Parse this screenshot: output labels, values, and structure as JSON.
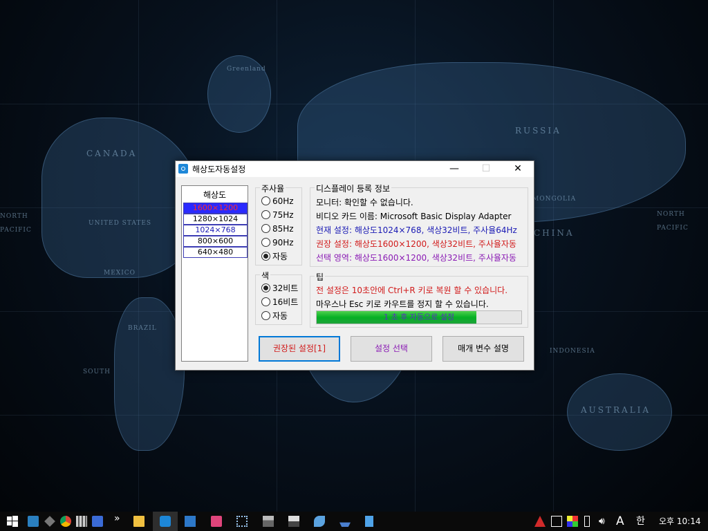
{
  "window": {
    "title": "해상도자동설정",
    "minimize": "—",
    "maximize": "☐",
    "close": "✕"
  },
  "resolution_list": {
    "header": "해상도",
    "items": [
      "1600×1200",
      "1280×1024",
      "1024×768",
      "800×600",
      "640×480"
    ],
    "selected": "1600×1200"
  },
  "refresh_rate": {
    "title": "주사율",
    "options": [
      "60Hz",
      "75Hz",
      "85Hz",
      "90Hz",
      "자동"
    ],
    "selected": "자동"
  },
  "color": {
    "title": "색",
    "options": [
      "32비트",
      "16비트",
      "자동"
    ],
    "selected": "32비트"
  },
  "display_info": {
    "title": "디스플레이 등록 정보",
    "monitor": "모니터: 확인할 수 없습니다.",
    "video_card": "비디오 카드 이름: Microsoft Basic Display Adapter",
    "current": "현재 설정: 해상도1024×768, 색상32비트, 주사율64Hz",
    "recommended": "권장 설정: 해상도1600×1200, 색상32비트, 주사율자동",
    "selected": "선택 영역: 해상도1600×1200, 색상32비트, 주사율자동"
  },
  "tip": {
    "title": "팁",
    "line1": "전 설정은 10초안에 Ctrl+R 키로 복원 할 수 있습니다.",
    "line2": "마우스나 Esc 키로 카우트를 정지 할 수 있습니다.",
    "progress_text": "1 초 후 자동으로 설정",
    "progress_fraction": 0.78
  },
  "buttons": {
    "recommended": "권장된 설정[1]",
    "select": "설정 선택",
    "params": "매개 변수 설명"
  },
  "map_labels": {
    "canada": "CANADA",
    "united_states": "UNITED STATES",
    "russia": "RUSSIA",
    "mongolia": "MONGOLIA",
    "china": "CHINA",
    "indonesia": "INDONESIA",
    "australia": "AUSTRALIA",
    "north_pacific": "NORTH",
    "north_pacific2": "PACIFIC",
    "south_atlantic": "SOUTH",
    "greenland": "Greenland",
    "mexico": "MEXICO",
    "brazil": "BRAZIL"
  },
  "taskbar": {
    "clock": "오후 10:14",
    "ime": "A",
    "lang": "한",
    "overflow": "»"
  },
  "colors": {
    "selected_bg": "#2a2aff",
    "selected_text": "#ff2a2a",
    "current_line": "#1a1ab4",
    "recommended_line": "#d11a1a",
    "selected_line": "#8a1ab4",
    "tip_line": "#d11a1a",
    "progress_green": "#06b025",
    "button_focus_border": "#0078d7"
  }
}
